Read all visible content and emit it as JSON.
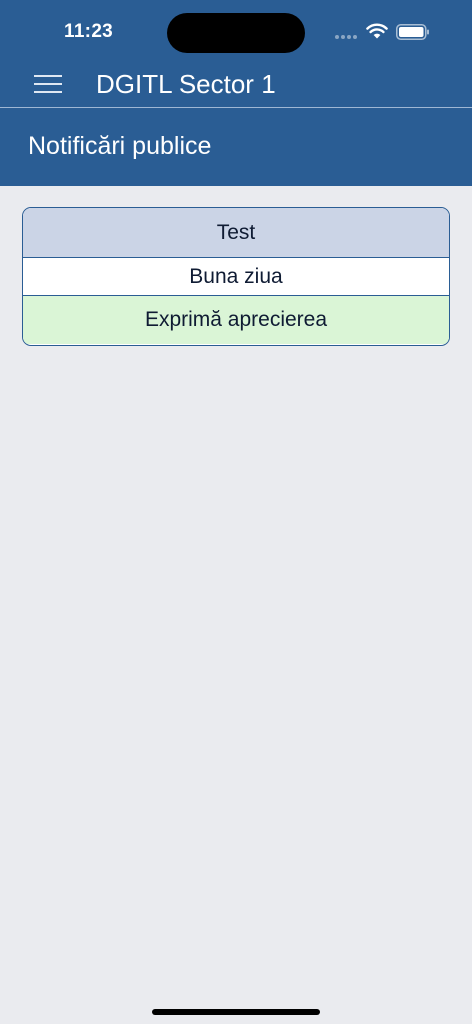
{
  "status_bar": {
    "time": "11:23"
  },
  "app_bar": {
    "title": "DGITL Sector 1",
    "menu_icon": "hamburger-menu-icon"
  },
  "page_header": {
    "title": "Notificări publice"
  },
  "notifications": [
    {
      "title": "Test",
      "body": "Buna ziua",
      "action_label": "Exprimă aprecierea"
    }
  ],
  "colors": {
    "primary": "#2a5d94",
    "background": "#eaebef",
    "card_title_bg": "#cbd4e6",
    "action_bg": "#daf5d6"
  }
}
